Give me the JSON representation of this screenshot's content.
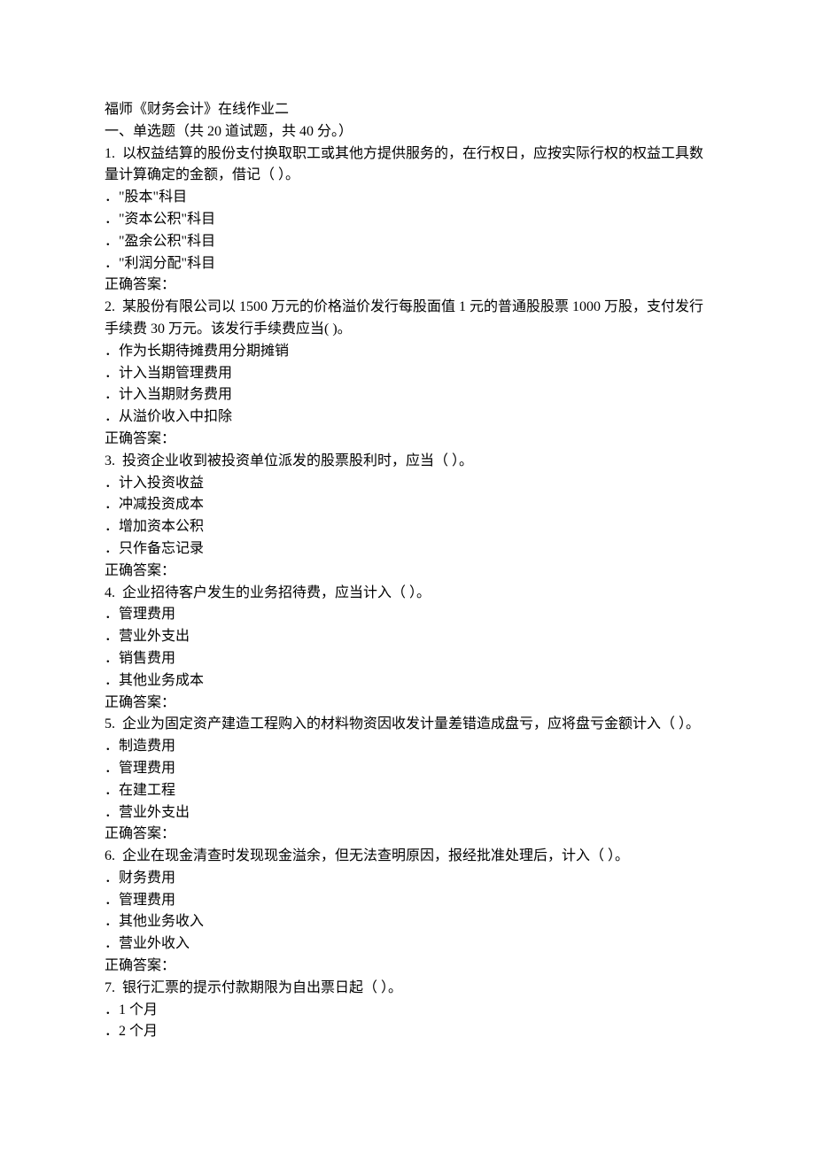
{
  "header": {
    "title": "福师《财务会计》在线作业二",
    "section_label": "一、单选题（共 20 道试题，共 40 分。）"
  },
  "questions": [
    {
      "number": "1.",
      "stem": "以权益结算的股份支付换取职工或其他方提供服务的，在行权日，应按实际行权的权益工具数量计算确定的金额，借记（ ）。",
      "options": [
        "\"股本\"科目",
        "\"资本公积\"科目",
        "\"盈余公积\"科目",
        "\"利润分配\"科目"
      ],
      "answer_label": "正确答案："
    },
    {
      "number": "2.",
      "stem": "某股份有限公司以 1500 万元的价格溢价发行每股面值 1 元的普通股股票 1000 万股，支付发行手续费 30 万元。该发行手续费应当( )。",
      "options": [
        "作为长期待摊费用分期摊销",
        "计入当期管理费用",
        "计入当期财务费用",
        "从溢价收入中扣除"
      ],
      "answer_label": "正确答案："
    },
    {
      "number": "3.",
      "stem": "投资企业收到被投资单位派发的股票股利时，应当（ ）。",
      "options": [
        "计入投资收益",
        "冲减投资成本",
        "增加资本公积",
        "只作备忘记录"
      ],
      "answer_label": "正确答案："
    },
    {
      "number": "4.",
      "stem": "企业招待客户发生的业务招待费，应当计入（ ）。",
      "options": [
        "管理费用",
        "营业外支出",
        "销售费用",
        "其他业务成本"
      ],
      "answer_label": "正确答案："
    },
    {
      "number": "5.",
      "stem": "企业为固定资产建造工程购入的材料物资因收发计量差错造成盘亏，应将盘亏金额计入（ ）。",
      "options": [
        "制造费用",
        "管理费用",
        "在建工程",
        "营业外支出"
      ],
      "answer_label": "正确答案："
    },
    {
      "number": "6.",
      "stem": "企业在现金清查时发现现金溢余，但无法查明原因，报经批准处理后，计入（ ）。",
      "options": [
        "财务费用",
        "管理费用",
        "其他业务收入",
        "营业外收入"
      ],
      "answer_label": "正确答案："
    },
    {
      "number": "7.",
      "stem": "银行汇票的提示付款期限为自出票日起（ ）。",
      "options": [
        "1 个月",
        "2 个月"
      ],
      "answer_label": ""
    }
  ]
}
